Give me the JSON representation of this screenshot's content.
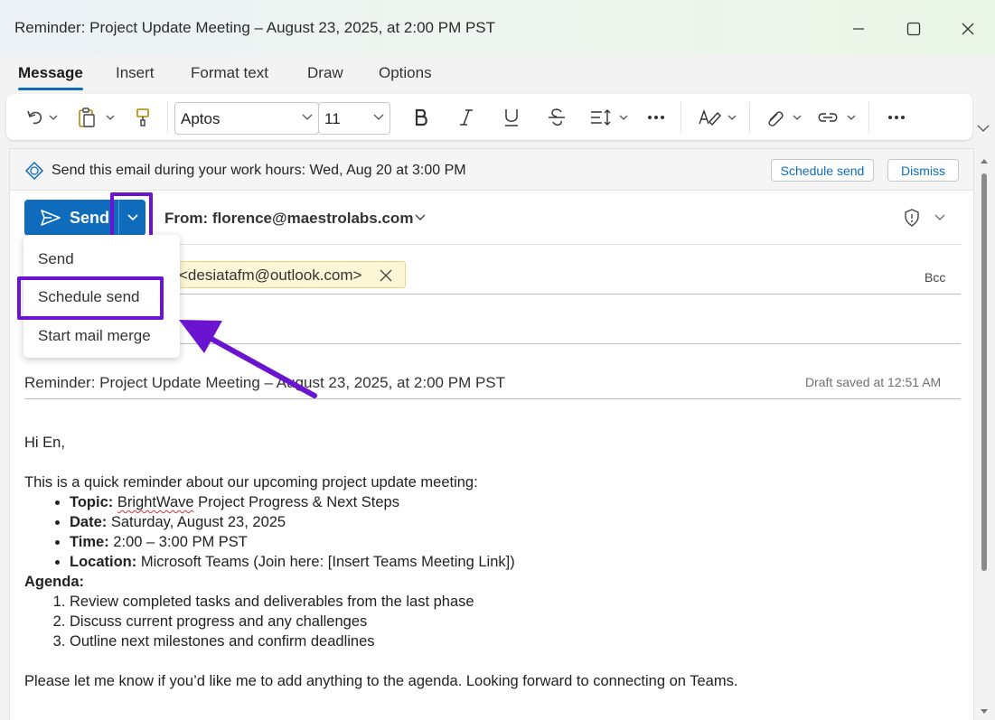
{
  "window": {
    "title": "Reminder: Project Update Meeting – August 23, 2025, at 2:00 PM PST"
  },
  "tabs": [
    "Message",
    "Insert",
    "Format text",
    "Draw",
    "Options"
  ],
  "ribbon": {
    "font_name": "Aptos",
    "font_size": "11"
  },
  "banner": {
    "text": "Send this email during your work hours: Wed, Aug 20 at 3:00 PM",
    "schedule_button": "Schedule send",
    "dismiss_button": "Dismiss"
  },
  "compose": {
    "send_label": "Send",
    "from": "From: florence@maestrolabs.com",
    "to_recipient": "<desiatafm@outlook.com>",
    "bcc": "Bcc",
    "subject": "Reminder: Project Update Meeting – August 23, 2025, at 2:00 PM PST",
    "draft_status": "Draft saved at 12:51 AM"
  },
  "dropdown": {
    "items": [
      "Send",
      "Schedule send",
      "Start mail merge"
    ]
  },
  "email_body": {
    "greeting": "Hi En,",
    "intro": "This is a quick reminder about our upcoming project update meeting:",
    "details": [
      {
        "label": "Topic:",
        "pre": "",
        "squiggle": "BrightWave",
        "value": " Project Progress & Next Steps"
      },
      {
        "label": "Date:",
        "pre": " Saturday, August 23, 2025",
        "squiggle": "",
        "value": ""
      },
      {
        "label": "Time:",
        "pre": " 2:00 – 3:00 PM PST",
        "squiggle": "",
        "value": ""
      },
      {
        "label": "Location:",
        "pre": " Microsoft Teams (Join here: [Insert Teams Meeting Link])",
        "squiggle": "",
        "value": ""
      }
    ],
    "agenda_heading": "Agenda:",
    "agenda": [
      "Review completed tasks and deliverables from the last phase",
      "Discuss current progress and any challenges",
      "Outline next milestones and confirm deadlines"
    ],
    "closing": "Please let me know if you’d like me to add anything to the agenda. Looking forward to connecting on Teams."
  },
  "colors": {
    "accent": "#0f6cbd",
    "highlight": "#6a14d1",
    "chip_bg": "#fdf6d6"
  }
}
